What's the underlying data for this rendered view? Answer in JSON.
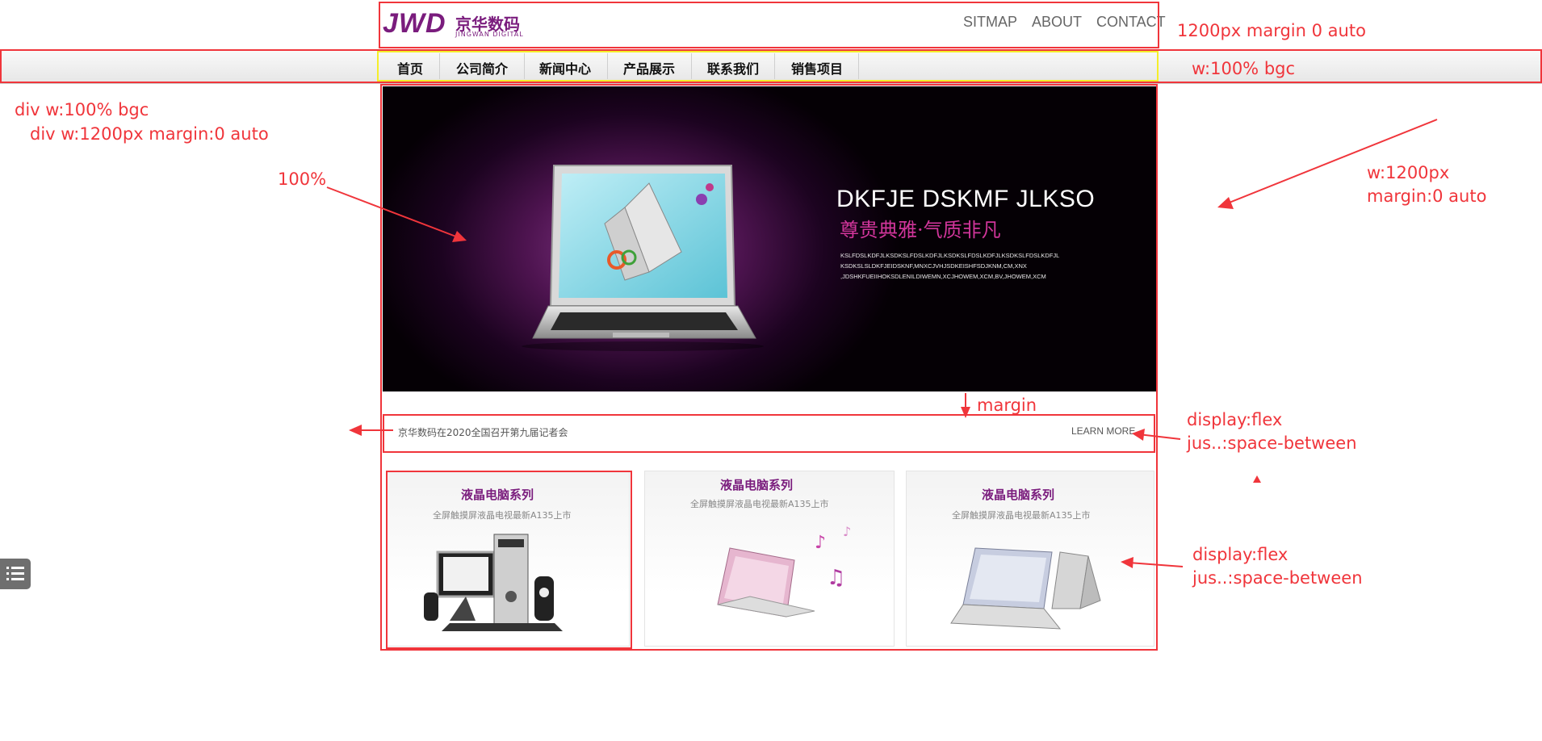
{
  "header": {
    "logo_main": "JWD",
    "logo_cn": "京华数码",
    "logo_en": "JINGWAN DIGITAL",
    "links": [
      "SITMAP",
      "ABOUT",
      "CONTACT"
    ]
  },
  "nav": {
    "items": [
      "首页",
      "公司简介",
      "新闻中心",
      "产品展示",
      "联系我们",
      "销售项目"
    ]
  },
  "banner": {
    "title": "DKFJE DSKMF JLKSO",
    "subtitle": "尊贵典雅·气质非凡",
    "lines": [
      "KSLFDSLKDFJLKSDKSLFDSLKDFJLKSDKSLFDSLKDFJLKSDKSLFDSLKDFJL",
      "KSDKSLSLDKFJEIDSKNF,MNXCJVHJSDKEISHFSDJKNM,CM,XNX",
      ",JDSHKFUEIIHOKSDLENILDIWEMN,XCJHOWEM,XCM,BV,JHOWEM,XCM"
    ]
  },
  "news": {
    "text": "京华数码在2020全国召开第九届记者会",
    "more": "LEARN MORE"
  },
  "products": [
    {
      "title": "液晶电脑系列",
      "desc": "全屏触摸屏液晶电视最新A135上市"
    },
    {
      "title": "液晶电脑系列",
      "desc": "全屏触摸屏液晶电视最新A135上市"
    },
    {
      "title": "液晶电脑系列",
      "desc": "全屏触摸屏液晶电视最新A135上市"
    }
  ],
  "annotations": {
    "header_note": "1200px  margin 0 auto",
    "nav_note": "w:100%  bgc",
    "div_outer": "div   w:100%  bgc",
    "div_inner": "div  w:1200px margin:0 auto",
    "pct": "100%",
    "w1200": "w:1200px",
    "margin_auto": "margin:0 auto",
    "margin": "margin",
    "flex1a": "display:flex",
    "flex1b": "jus..:space-between",
    "flex2a": "display:flex",
    "flex2b": "jus..:space-between"
  },
  "colors": {
    "brand": "#7a1c7d",
    "annotation": "#f0353b",
    "highlight": "#f5ee2a"
  }
}
